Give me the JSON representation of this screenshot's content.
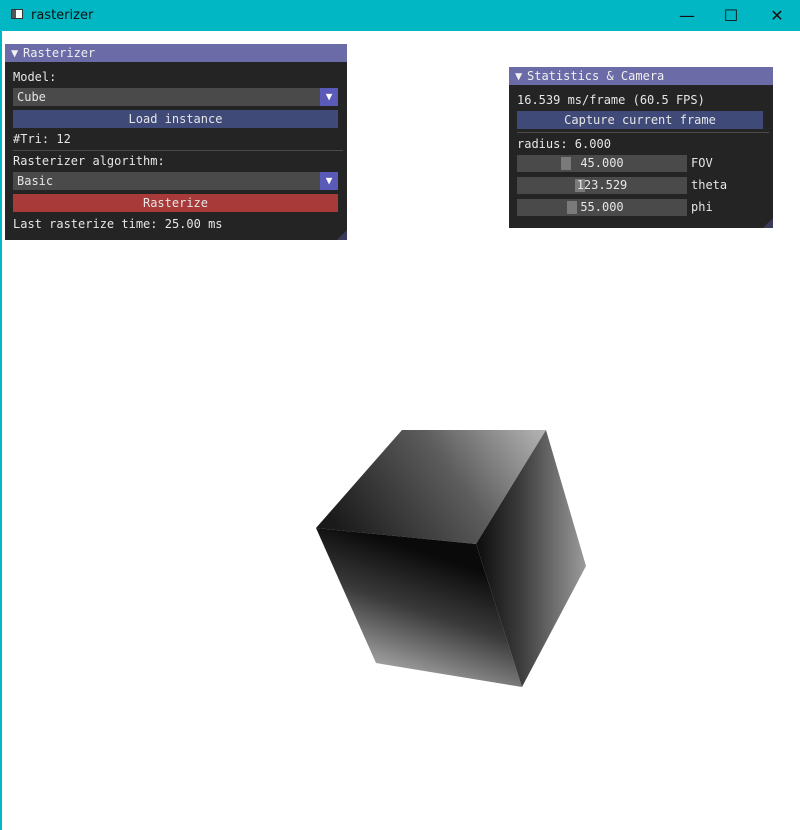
{
  "window": {
    "title": "rasterizer",
    "minimize_glyph": "—",
    "maximize_glyph": "☐",
    "close_glyph": "✕"
  },
  "rasterizer_panel": {
    "title": "Rasterizer",
    "model_label": "Model:",
    "model_value": "Cube",
    "load_button": "Load instance",
    "tri_count": "#Tri: 12",
    "algorithm_label": "Rasterizer algorithm:",
    "algorithm_value": "Basic",
    "rasterize_button": "Rasterize",
    "last_time": "Last rasterize time: 25.00 ms"
  },
  "stats_panel": {
    "title": "Statistics & Camera",
    "frame_stats": "16.539 ms/frame (60.5 FPS)",
    "capture_button": "Capture current frame",
    "radius": "radius: 6.000",
    "sliders": [
      {
        "value": "45.000",
        "label": "FOV",
        "level": 0.27
      },
      {
        "value": "123.529",
        "label": "theta",
        "level": 0.36
      },
      {
        "value": "55.000",
        "label": "phi",
        "level": 0.31
      }
    ]
  },
  "colors": {
    "titlebar": "#00b7c3",
    "panel_header": "#6b6ba8",
    "button": "#3f4a78",
    "rasterize_button": "#a83a3a"
  }
}
